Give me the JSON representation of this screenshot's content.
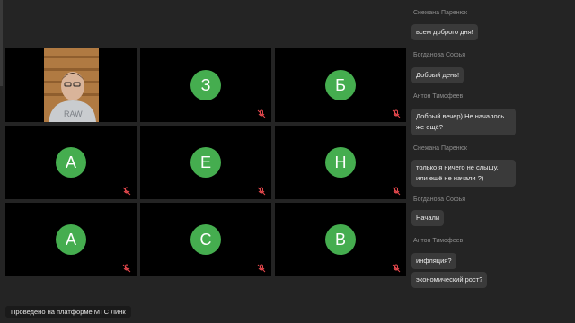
{
  "participants": [
    {
      "initial": "",
      "has_video": true,
      "muted": false
    },
    {
      "initial": "З",
      "has_video": false,
      "muted": true
    },
    {
      "initial": "Б",
      "has_video": false,
      "muted": true
    },
    {
      "initial": "А",
      "has_video": false,
      "muted": true
    },
    {
      "initial": "Е",
      "has_video": false,
      "muted": true
    },
    {
      "initial": "Н",
      "has_video": false,
      "muted": true
    },
    {
      "initial": "А",
      "has_video": false,
      "muted": true
    },
    {
      "initial": "С",
      "has_video": false,
      "muted": true
    },
    {
      "initial": "В",
      "has_video": false,
      "muted": true
    }
  ],
  "chat": {
    "messages": [
      {
        "author": "Снежана Паренюк",
        "text": "всем доброго дня!"
      },
      {
        "author": "Богданова Софья",
        "text": "Добрый день!"
      },
      {
        "author": "Антон Тимофеев",
        "text": "Добрый вечер) Не началось же ещё?"
      },
      {
        "author": "Снежана Паренюк",
        "text": "только я ничего не слышу, или ещё не начали ?)"
      },
      {
        "author": "Богданова Софья",
        "text": "Начали"
      },
      {
        "author": "Антон Тимофеев",
        "text": "инфляция?"
      },
      {
        "author": "",
        "text": "экономический рост?"
      }
    ]
  },
  "footer": {
    "label": "Проведено на платформе МТС Линк"
  },
  "colors": {
    "avatar": "#45ad4f",
    "muted_icon": "#e5484d",
    "background": "#242424"
  }
}
